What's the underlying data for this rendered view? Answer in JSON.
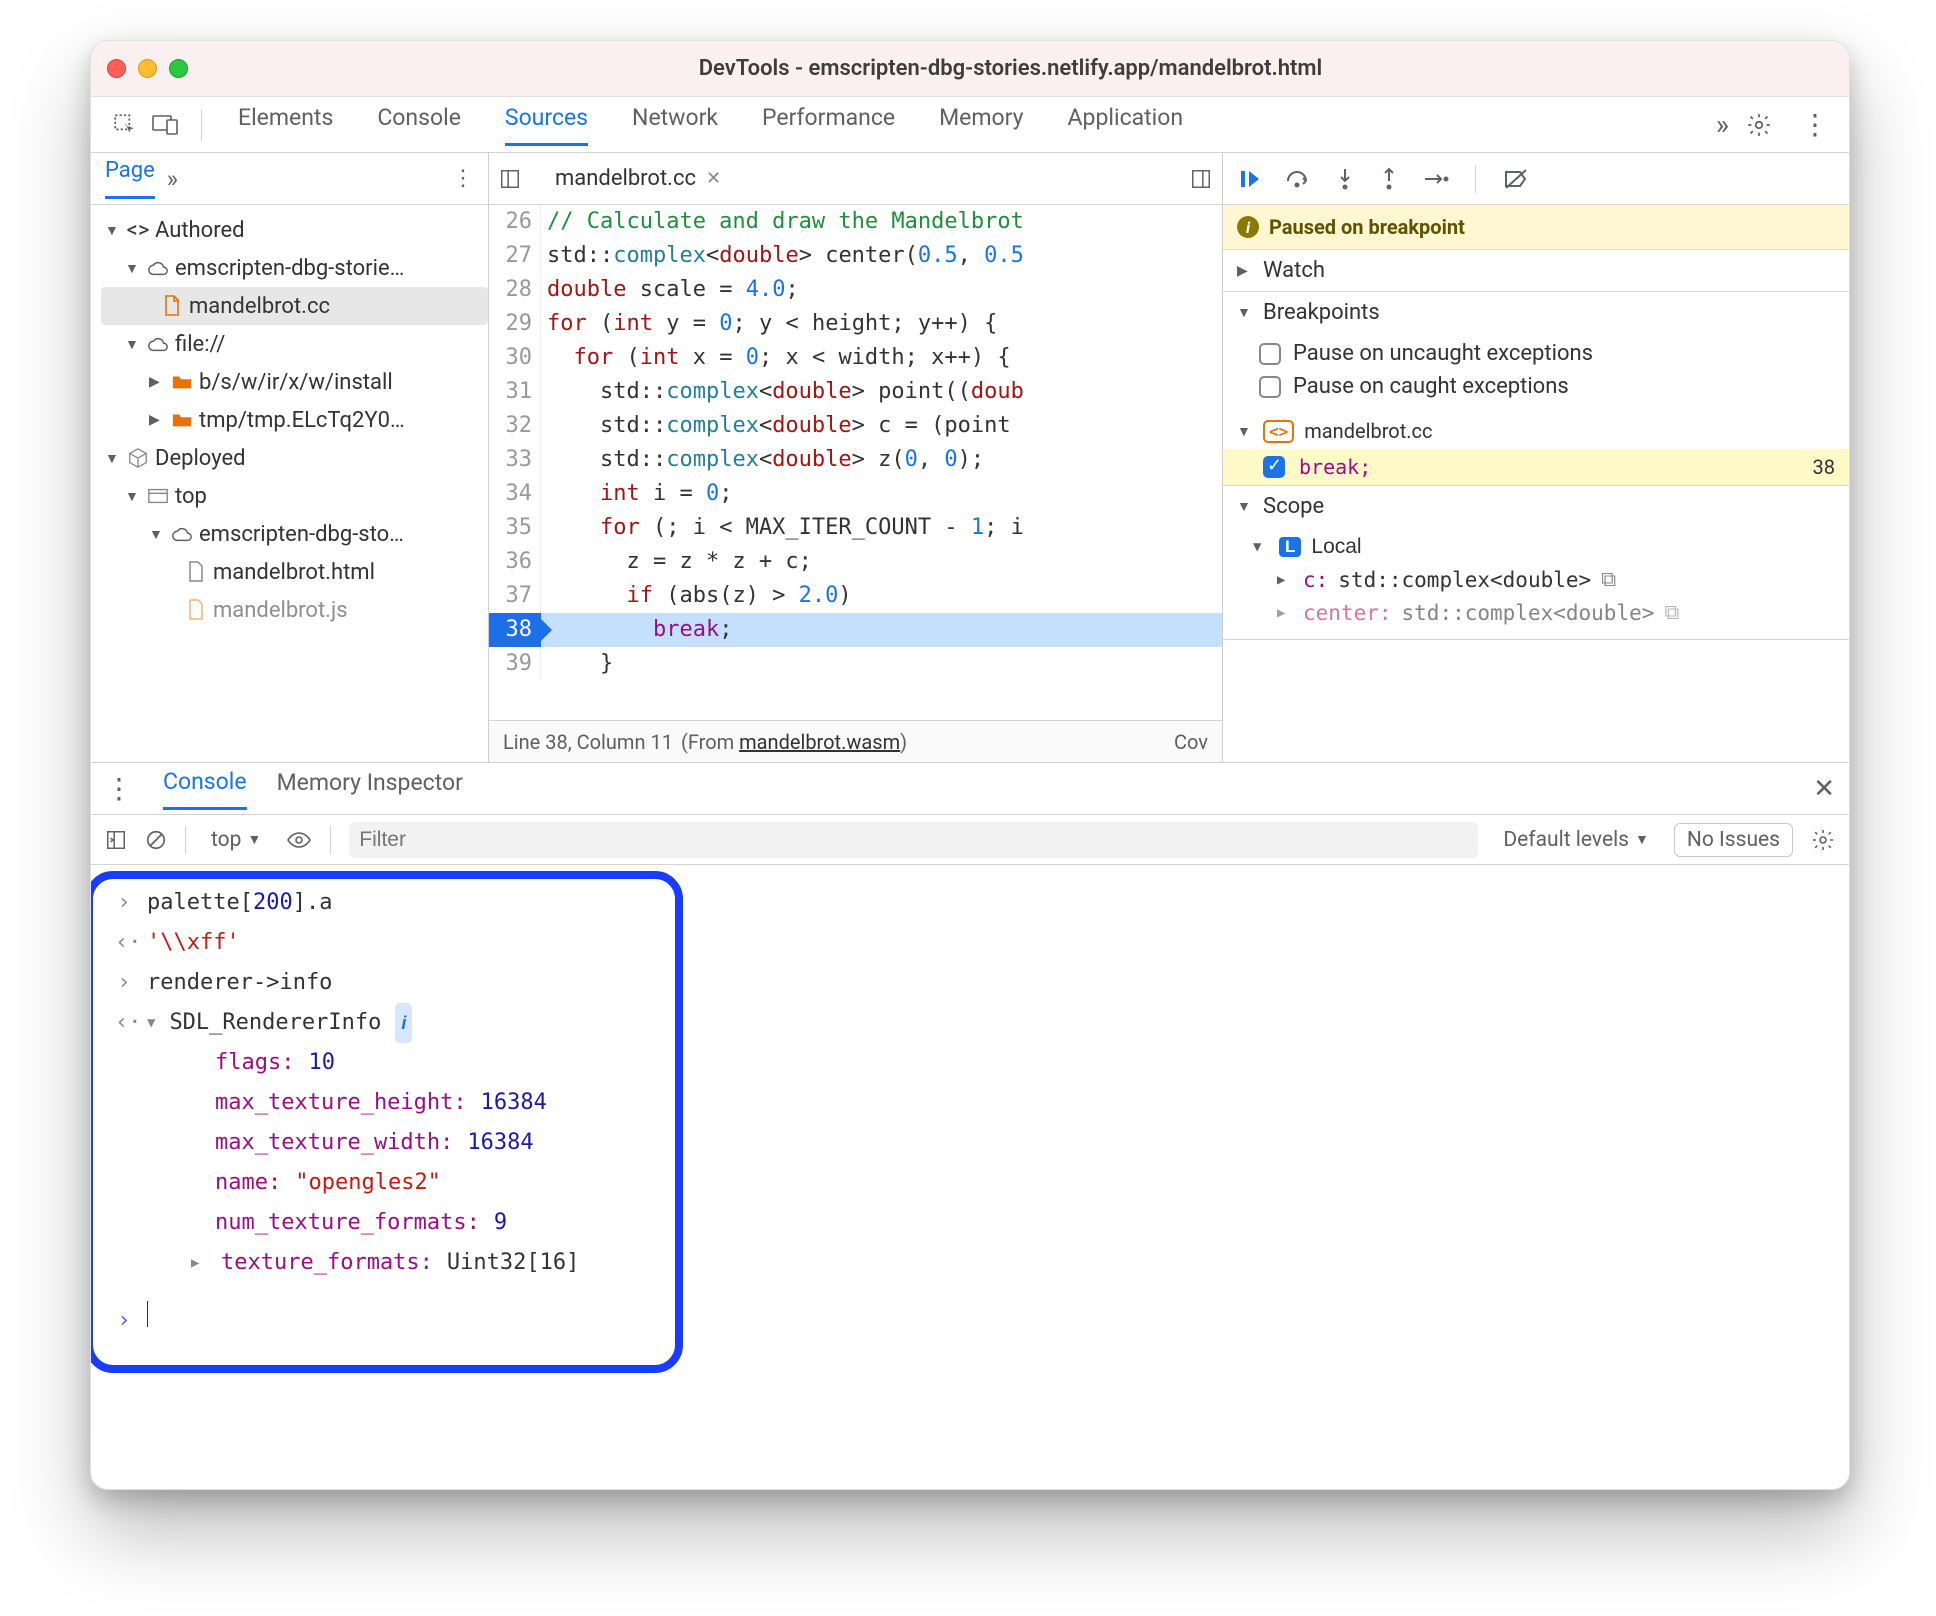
{
  "window": {
    "title": "DevTools - emscripten-dbg-stories.netlify.app/mandelbrot.html"
  },
  "toolbar": {
    "tabs": [
      "Elements",
      "Console",
      "Sources",
      "Network",
      "Performance",
      "Memory",
      "Application"
    ],
    "active": "Sources"
  },
  "left": {
    "tabname": "Page",
    "tree": {
      "authored": "Authored",
      "site": "emscripten-dbg-storie…",
      "file_active": "mandelbrot.cc",
      "file_scheme": "file://",
      "folder_a": "b/s/w/ir/x/w/install",
      "folder_b": "tmp/tmp.ELcTq2Y0…",
      "deployed": "Deployed",
      "top": "top",
      "site_long": "emscripten-dbg-sto…",
      "html": "mandelbrot.html",
      "js": "mandelbrot.js"
    }
  },
  "editor": {
    "tab_file": "mandelbrot.cc",
    "gutter_start": 26,
    "status": {
      "line": "Line 38, Column 11",
      "from": "mandelbrot.wasm",
      "cov": "Cov"
    },
    "lines": {
      "l26": "// Calculate and draw the Mandelbrot",
      "l27_a": "std",
      "l27_b": "::",
      "l27_c": "complex",
      "l27_d": "<",
      "l27_e": "double",
      "l27_f": "> center(",
      "l27_g": "0.5",
      "l27_h": ", ",
      "l27_i": "0.5",
      "l28_a": "double",
      "l28_b": " scale = ",
      "l28_c": "4.0",
      "l28_d": ";",
      "l29_a": "for",
      "l29_b": " (",
      "l29_c": "int",
      "l29_d": " y = ",
      "l29_e": "0",
      "l29_f": "; y < height; y++) {",
      "l30_a": "  for",
      "l30_b": " (",
      "l30_c": "int",
      "l30_d": " x = ",
      "l30_e": "0",
      "l30_f": "; x < width; x++) {",
      "l31_a": "    std",
      "l31_b": "::",
      "l31_c": "complex",
      "l31_d": "<",
      "l31_e": "double",
      "l31_f": "> point((",
      "l31_g": "doub",
      "l32_a": "    std",
      "l32_b": "::",
      "l32_c": "complex",
      "l32_d": "<",
      "l32_e": "double",
      "l32_f": "> c = (point ",
      "l33_a": "    std",
      "l33_b": "::",
      "l33_c": "complex",
      "l33_d": "<",
      "l33_e": "double",
      "l33_f": "> z(",
      "l33_g": "0",
      "l33_h": ", ",
      "l33_i": "0",
      "l33_j": ");",
      "l34_a": "    int",
      "l34_b": " i = ",
      "l34_c": "0",
      "l34_d": ";",
      "l35_a": "    for",
      "l35_b": " (; i < MAX_ITER_COUNT - ",
      "l35_c": "1",
      "l35_d": "; i",
      "l36": "      z = z * z + c;",
      "l37_a": "      if",
      "l37_b": " (abs(z) > ",
      "l37_c": "2.0",
      "l37_d": ")",
      "l38_a": "        break",
      "l38_b": ";",
      "l39": "    }"
    }
  },
  "debugger": {
    "paused": "Paused on breakpoint",
    "watch": "Watch",
    "breakpoints_label": "Breakpoints",
    "pause_uncaught": "Pause on uncaught exceptions",
    "pause_caught": "Pause on caught exceptions",
    "bp_file": "mandelbrot.cc",
    "bp_code": "break;",
    "bp_line": "38",
    "scope_label": "Scope",
    "local_label": "Local",
    "scope_rows": [
      {
        "k": "c:",
        "t": "std::complex<double>"
      },
      {
        "k": "center:",
        "t": "std::complex<double>"
      }
    ]
  },
  "drawer": {
    "tabs": [
      "Console",
      "Memory Inspector"
    ],
    "active": "Console",
    "ctx": "top",
    "filter_placeholder": "Filter",
    "levels": "Default levels",
    "issues": "No Issues"
  },
  "console": {
    "in1": "palette[",
    "in1n": "200",
    "in1b": "].a",
    "out1": "'\\\\xff'",
    "in2": "renderer->info",
    "obj_name": "SDL_RendererInfo",
    "flags_k": "flags:",
    "flags_v": "10",
    "mth_k": "max_texture_height:",
    "mth_v": "16384",
    "mtw_k": "max_texture_width:",
    "mtw_v": "16384",
    "name_k": "name:",
    "name_v": "\"opengles2\"",
    "ntf_k": "num_texture_formats:",
    "ntf_v": "9",
    "tf_k": "texture_formats:",
    "tf_v": "Uint32[16]"
  }
}
